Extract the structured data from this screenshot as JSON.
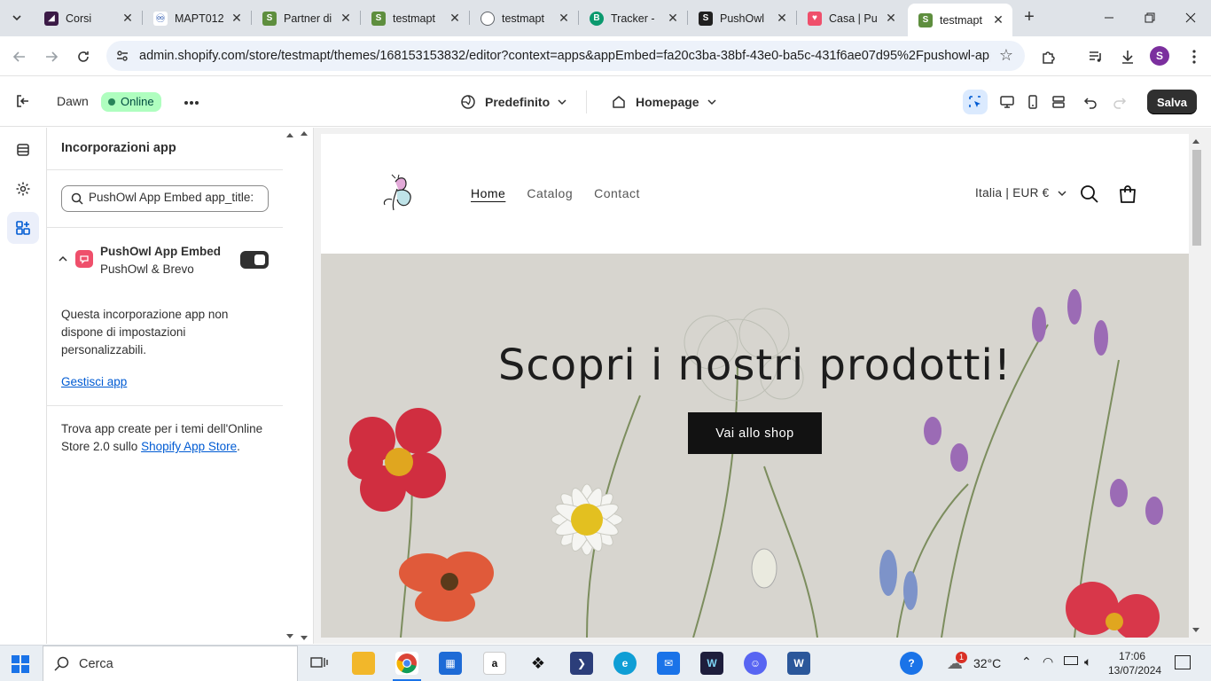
{
  "browser": {
    "tabs": [
      {
        "title": "Corsi",
        "color": "#3b1a46"
      },
      {
        "title": "MAPT012",
        "color": "#1a4aa8"
      },
      {
        "title": "Partner di",
        "color": "#5e8e3e"
      },
      {
        "title": "testmapt",
        "color": "#5e8e3e"
      },
      {
        "title": "testmapt",
        "color": "#5f6368"
      },
      {
        "title": "Tracker - ",
        "color": "#0b996e"
      },
      {
        "title": "PushOwl",
        "color": "#202020"
      },
      {
        "title": "Casa | Pu",
        "color": "#ef4f6b"
      },
      {
        "title": "testmapt",
        "color": "#5e8e3e"
      }
    ],
    "active_tab_index": 8,
    "url": "admin.shopify.com/store/testmapt/themes/168153153832/editor?context=apps&appEmbed=fa20c3ba-38bf-43e0-ba5c-431f6ae07d95%2Fpushowl-app-...",
    "profile_initial": "S"
  },
  "editor": {
    "theme_name": "Dawn",
    "status_badge": "Online",
    "template_label": "Predefinito",
    "page_label": "Homepage",
    "save_label": "Salva"
  },
  "panel": {
    "title": "Incorporazioni app",
    "search_value": "PushOwl App Embed app_title:",
    "embed": {
      "name": "PushOwl App Embed",
      "developer": "PushOwl & Brevo",
      "enabled": true
    },
    "embed_description": "Questa incorporazione app non dispone di impostazioni personalizzabili.",
    "manage_link": "Gestisci app",
    "find_prefix": "Trova app create per i temi dell'Online Store 2.0 sullo ",
    "find_link": "Shopify App Store",
    "find_suffix": "."
  },
  "store": {
    "nav": [
      "Home",
      "Catalog",
      "Contact"
    ],
    "locale": "Italia | EUR €",
    "hero_title": "Scopri i nostri prodotti!",
    "hero_button": "Vai allo shop"
  },
  "taskbar": {
    "search_placeholder": "Cerca",
    "temperature": "32°C",
    "weather_badge": "1",
    "time": "17:06",
    "date": "13/07/2024"
  },
  "colors": {
    "accent_blue": "#005bd3",
    "online_badge": "#affebf",
    "save_button": "#303030"
  }
}
